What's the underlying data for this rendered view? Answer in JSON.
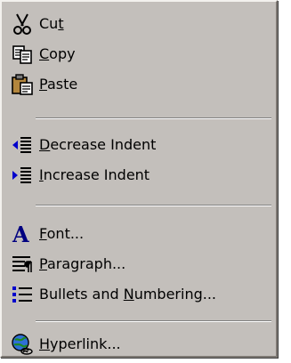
{
  "menu": {
    "items": [
      {
        "name": "cut",
        "prefix": "Cu",
        "accel": "t",
        "suffix": "",
        "icon": "scissors-icon"
      },
      {
        "name": "copy",
        "prefix": "",
        "accel": "C",
        "suffix": "opy",
        "icon": "copy-icon"
      },
      {
        "name": "paste",
        "prefix": "",
        "accel": "P",
        "suffix": "aste",
        "icon": "paste-icon"
      },
      {
        "name": "decrease-indent",
        "prefix": "",
        "accel": "D",
        "suffix": "ecrease Indent",
        "icon": "decrease-indent-icon"
      },
      {
        "name": "increase-indent",
        "prefix": "",
        "accel": "I",
        "suffix": "ncrease Indent",
        "icon": "increase-indent-icon"
      },
      {
        "name": "font",
        "prefix": "",
        "accel": "F",
        "suffix": "ont...",
        "icon": "font-icon"
      },
      {
        "name": "paragraph",
        "prefix": "",
        "accel": "P",
        "suffix": "aragraph...",
        "icon": "paragraph-icon"
      },
      {
        "name": "bullets-numbering",
        "prefix": "Bullets and ",
        "accel": "N",
        "suffix": "umbering...",
        "icon": "bullets-icon"
      },
      {
        "name": "hyperlink",
        "prefix": "",
        "accel": "H",
        "suffix": "yperlink...",
        "icon": "hyperlink-icon"
      }
    ]
  }
}
